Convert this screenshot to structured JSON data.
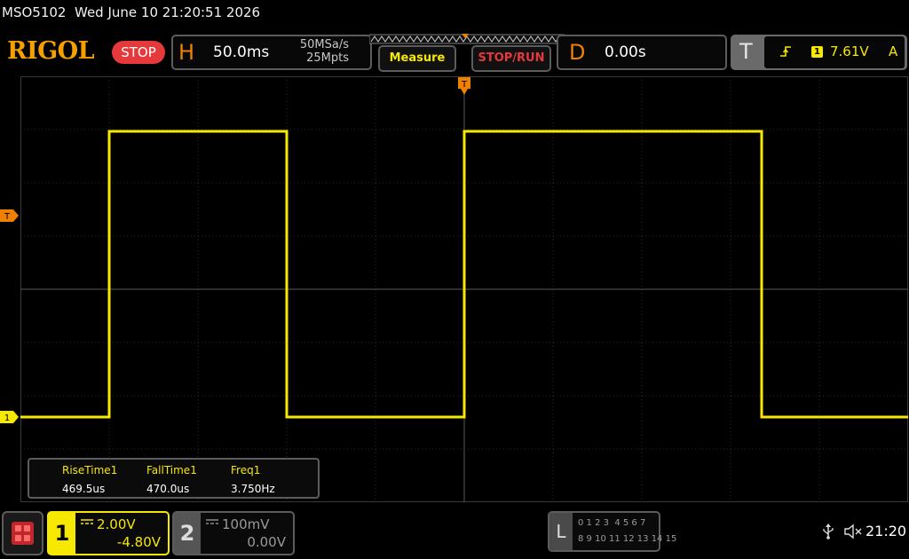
{
  "header": {
    "model": "MSO5102",
    "datetime": "Wed June 10 21:20:51 2026",
    "brand": "RIGOL",
    "run_state": "STOP"
  },
  "horizontal": {
    "letter": "H",
    "time_scale": "50.0ms",
    "sample_rate": "50MSa/s",
    "memory_depth": "25Mpts"
  },
  "buttons": {
    "measure": "Measure",
    "stop_run": "STOP/RUN"
  },
  "delay": {
    "letter": "D",
    "value": "0.00s"
  },
  "trigger": {
    "letter": "T",
    "edge_icon": "rising-edge-icon",
    "source": "1",
    "level": "7.61V",
    "mode": "A"
  },
  "markers": {
    "trigger_position": "T",
    "trigger_level": "T",
    "channel1": "1"
  },
  "measurements": [
    {
      "name": "RiseTime1",
      "value": "469.5us"
    },
    {
      "name": "FallTime1",
      "value": "470.0us"
    },
    {
      "name": "Freq1",
      "value": "3.750Hz"
    }
  ],
  "channels": {
    "ch1": {
      "number": "1",
      "coupling_icon": "dc-coupling-icon",
      "scale": "2.00V",
      "offset": "-4.80V",
      "color": "#f6e800"
    },
    "ch2": {
      "number": "2",
      "coupling_icon": "dc-coupling-icon",
      "scale": "100mV",
      "offset": "0.00V",
      "color": "#9a9a9a"
    }
  },
  "logic": {
    "letter": "L",
    "row1": "0 1 2 3  4 5 6 7",
    "row2": "8 9 10 11 12 13 14 15"
  },
  "status": {
    "usb_icon": "usb-icon",
    "sound_icon": "speaker-muted-icon",
    "time": "21:20"
  },
  "colors": {
    "trace": "#f6e800",
    "accent": "#f08000",
    "stop": "#e5393b"
  },
  "chart_data": {
    "type": "line",
    "series": [
      {
        "x_divisions": [
          0,
          1.0,
          1.0,
          3.0,
          3.0,
          5.0,
          5.0,
          8.35,
          8.35,
          10
        ],
        "level": [
          "low",
          "low",
          "high",
          "high",
          "low",
          "low",
          "high",
          "high",
          "low",
          "low"
        ]
      }
    ],
    "grid": true,
    "divisions": {
      "x": 10,
      "y": 8
    }
  }
}
